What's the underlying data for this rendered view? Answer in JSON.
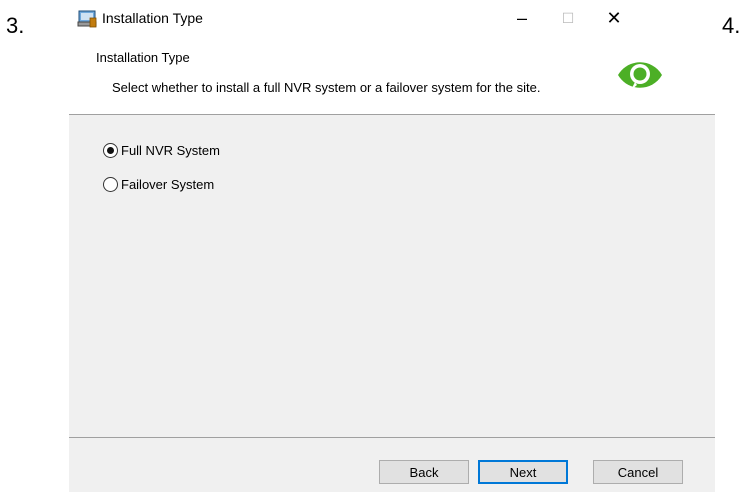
{
  "steps": {
    "left": "3.",
    "right": "4."
  },
  "window": {
    "title": "Installation Type",
    "controls": {
      "minimize": "–",
      "maximize": "☐",
      "close": "✕"
    }
  },
  "header": {
    "title": "Installation Type",
    "description": "Select whether to install a full NVR system or a failover system for the site."
  },
  "options": [
    {
      "label": "Full NVR System",
      "selected": true
    },
    {
      "label": "Failover System",
      "selected": false
    }
  ],
  "buttons": {
    "back": "Back",
    "next": "Next",
    "cancel": "Cancel"
  },
  "colors": {
    "logo": "#4caf26",
    "focus": "#0078d7"
  }
}
